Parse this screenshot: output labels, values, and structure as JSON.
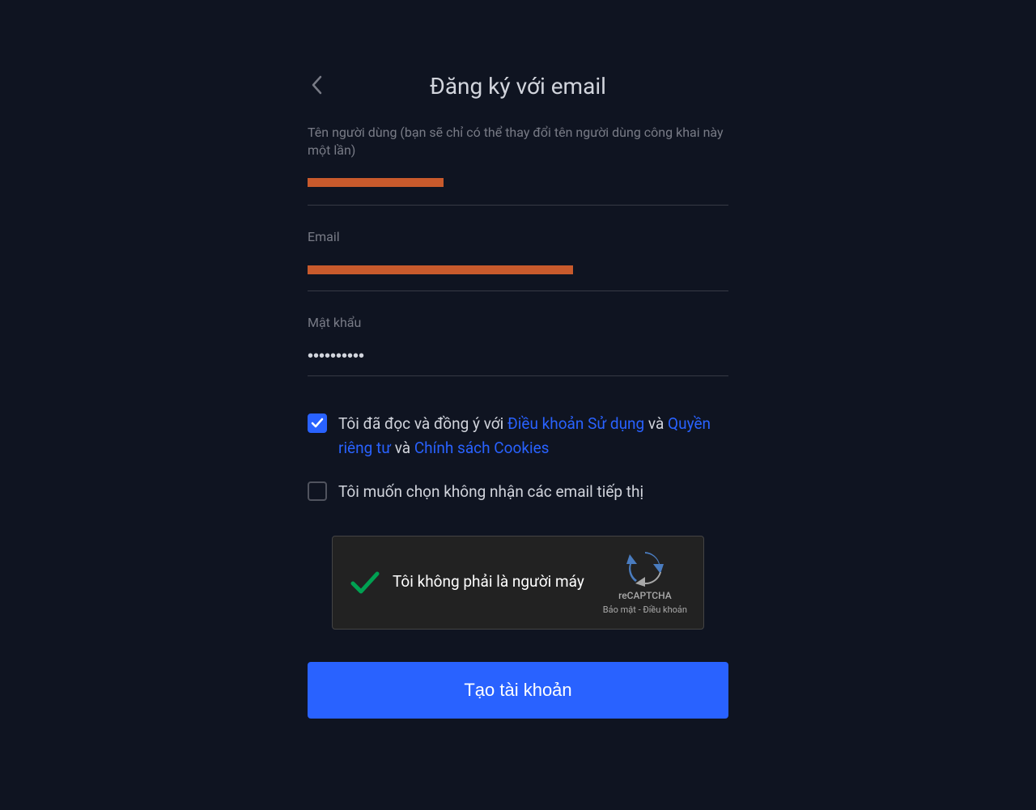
{
  "header": {
    "title": "Đăng ký với email"
  },
  "fields": {
    "username": {
      "label": "Tên người dùng (bạn sẽ chỉ có thể thay đổi tên người dùng công khai này một lần)"
    },
    "email": {
      "label": "Email"
    },
    "password": {
      "label": "Mật khẩu",
      "value": "••••••••••"
    }
  },
  "terms": {
    "prefix": "Tôi đã đọc và đồng ý với ",
    "tos_link": "Điều khoản Sử dụng",
    "and1": " và ",
    "privacy_link": "Quyền riêng tư",
    "and2": " và ",
    "cookies_link": "Chính sách Cookies",
    "checked": true
  },
  "marketing": {
    "label": "Tôi muốn chọn không nhận các email tiếp thị",
    "checked": false
  },
  "recaptcha": {
    "text": "Tôi không phải là người máy",
    "brand": "reCAPTCHA",
    "links": "Bảo mật - Điều khoản"
  },
  "submit": {
    "label": "Tạo tài khoản"
  }
}
